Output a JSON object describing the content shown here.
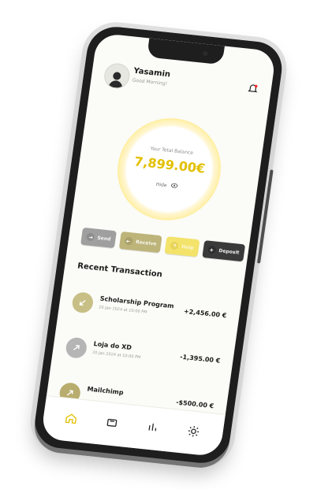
{
  "profile": {
    "name": "Yasamin",
    "subtitle": "Good Morning!"
  },
  "balance": {
    "label": "Your Total Balance",
    "amount": "7,899.00€",
    "hide_label": "Hide"
  },
  "actions": [
    {
      "label": "Send"
    },
    {
      "label": "Receive"
    },
    {
      "label": "Help"
    },
    {
      "label": "Deposit"
    }
  ],
  "recent": {
    "title": "Recent Transaction",
    "items": [
      {
        "title": "Scholarship Program",
        "date": "20 Jan 2024 at 10:00 PM",
        "amount": "+2,456.00 €"
      },
      {
        "title": "Loja do XD",
        "date": "20 Jan 2024 at 10:00 PM",
        "amount": "-1,395.00 €"
      },
      {
        "title": "Mailchimp",
        "date": "",
        "amount": "-$500.00 €"
      }
    ]
  },
  "tabbar": {
    "items": [
      {
        "icon": "home-icon"
      },
      {
        "icon": "wallet-icon"
      },
      {
        "icon": "stats-icon"
      },
      {
        "icon": "gear-icon"
      }
    ]
  },
  "colors": {
    "accent": "#e2c000",
    "screen_bg": "#fbfbf7",
    "frame": "#1e1e1e"
  }
}
